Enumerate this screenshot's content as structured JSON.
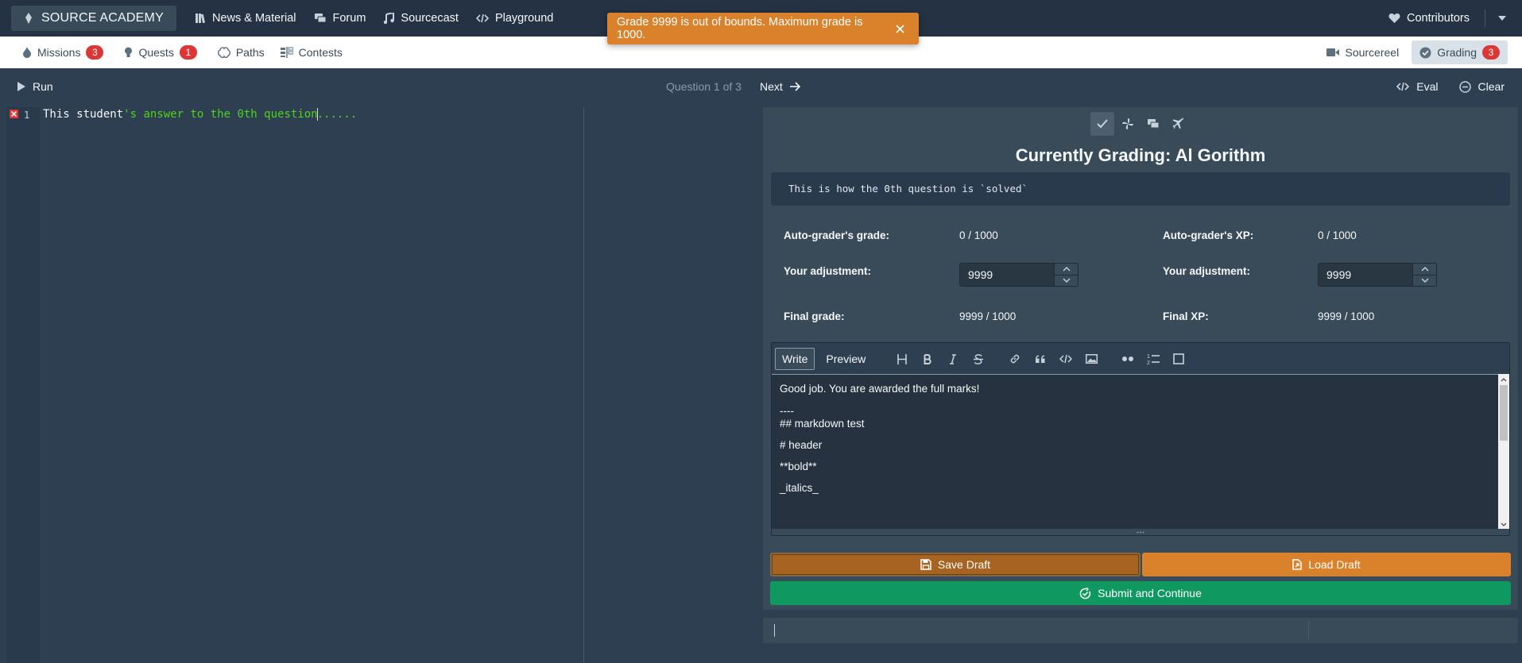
{
  "navbar": {
    "brand": "SOURCE ACADEMY",
    "items": [
      "News & Material",
      "Forum",
      "Sourcecast",
      "Playground"
    ],
    "contributors": "Contributors"
  },
  "toast": {
    "message": "Grade 9999 is out of bounds. Maximum grade is 1000.",
    "color": "#d9822b"
  },
  "subnav": {
    "missions": {
      "label": "Missions",
      "count": "3"
    },
    "quests": {
      "label": "Quests",
      "count": "1"
    },
    "paths": "Paths",
    "contests": "Contests",
    "sourcereel": "Sourcereel",
    "grading": {
      "label": "Grading",
      "count": "3"
    }
  },
  "controlbar": {
    "run": "Run",
    "question_counter": "Question 1 of 3",
    "next": "Next",
    "eval": "Eval",
    "clear": "Clear"
  },
  "editor": {
    "line_number": "1",
    "code_part1": "This student",
    "code_part2": "'s answer to the 0th question",
    "code_part3": "......"
  },
  "grading": {
    "title": "Currently Grading: Al Gorithm",
    "solution": "This is how the 0th question is `solved`",
    "autograder_grade_label": "Auto-grader's grade:",
    "autograder_grade_value": "0 / 1000",
    "autograder_xp_label": "Auto-grader's XP:",
    "autograder_xp_value": "0 / 1000",
    "grade_adjustment_label": "Your adjustment:",
    "grade_adjustment_value": "9999",
    "xp_adjustment_label": "Your adjustment:",
    "xp_adjustment_value": "9999",
    "final_grade_label": "Final grade:",
    "final_grade_value": "9999 / 1000",
    "final_xp_label": "Final XP:",
    "final_xp_value": "9999 / 1000"
  },
  "markdown": {
    "write_tab": "Write",
    "preview_tab": "Preview",
    "lines": [
      "Good job. You are awarded the full marks!",
      "----",
      "## markdown test",
      "# header",
      "**bold**",
      "_italics_"
    ]
  },
  "buttons": {
    "save_draft": "Save Draft",
    "load_draft": "Load Draft",
    "submit": "Submit and Continue"
  },
  "colors": {
    "save": "#a66321",
    "load": "#d9822b",
    "submit": "#0f9960",
    "badge": "#db3737"
  }
}
